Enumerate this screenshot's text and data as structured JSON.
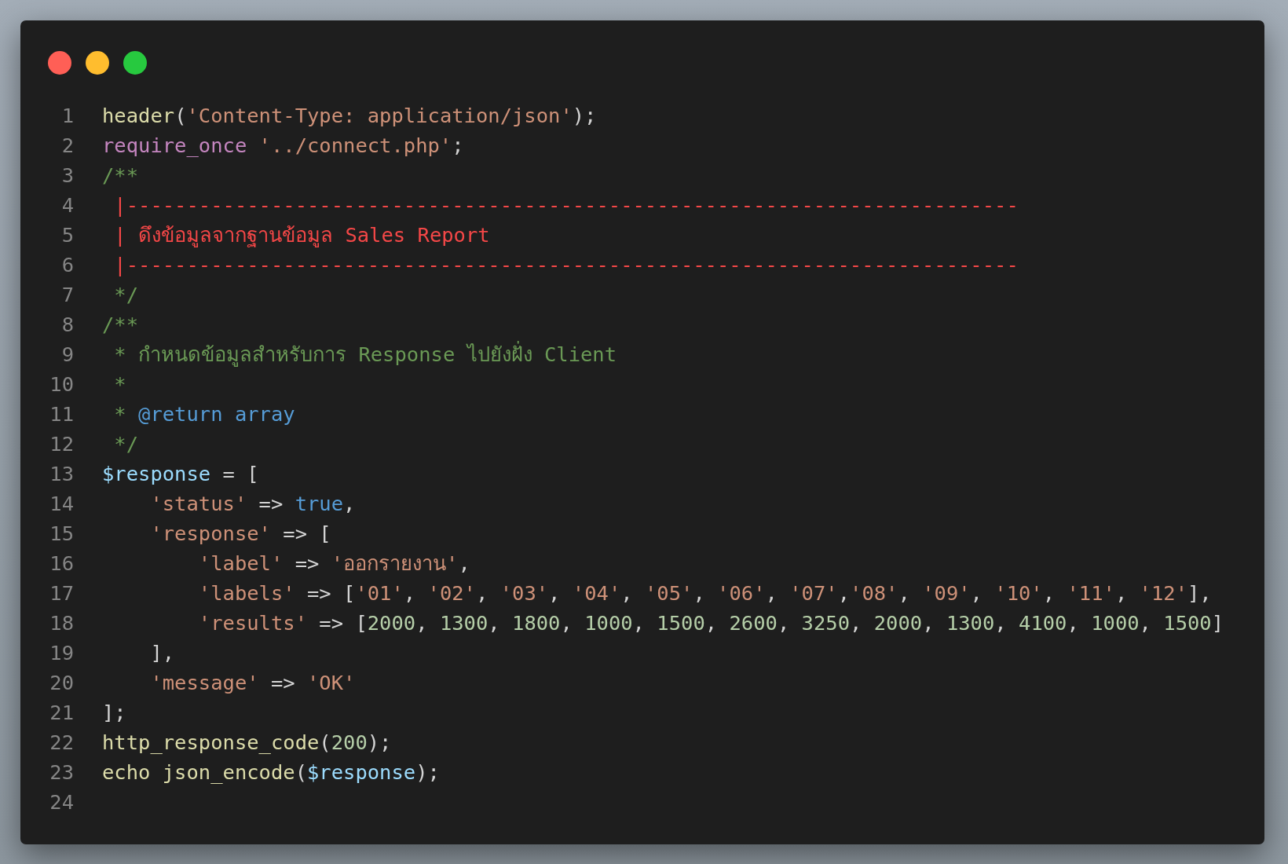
{
  "window": {
    "controls": [
      {
        "color": "#ff5f56"
      },
      {
        "color": "#ffbd2e"
      },
      {
        "color": "#27c93f"
      }
    ]
  },
  "lines": [
    {
      "number": "1",
      "tokens": [
        {
          "kind": "fn",
          "text": "header"
        },
        {
          "kind": "plain",
          "text": "("
        },
        {
          "kind": "str",
          "text": "'Content-Type: application/json'"
        },
        {
          "kind": "plain",
          "text": ");"
        }
      ]
    },
    {
      "number": "2",
      "tokens": [
        {
          "kind": "kw",
          "text": "require_once"
        },
        {
          "kind": "str",
          "text": " '../connect.php'"
        },
        {
          "kind": "plain",
          "text": ";"
        }
      ]
    },
    {
      "number": "3",
      "tokens": [
        {
          "kind": "comment",
          "text": "/**"
        }
      ]
    },
    {
      "number": "4",
      "tokens": [
        {
          "kind": "alert",
          "text": " |--------------------------------------------------------------------------"
        }
      ]
    },
    {
      "number": "5",
      "tokens": [
        {
          "kind": "alert",
          "text": " | ดึงข้อมูลจากฐานข้อมูล Sales Report"
        }
      ]
    },
    {
      "number": "6",
      "tokens": [
        {
          "kind": "alert",
          "text": " |--------------------------------------------------------------------------"
        }
      ]
    },
    {
      "number": "7",
      "tokens": [
        {
          "kind": "comment",
          "text": " */"
        }
      ]
    },
    {
      "number": "8",
      "tokens": [
        {
          "kind": "comment",
          "text": "/**"
        }
      ]
    },
    {
      "number": "9",
      "tokens": [
        {
          "kind": "comment",
          "text": " * กำหนดข้อมูลสำหรับการ Response ไปยังฝั่ง Client"
        }
      ]
    },
    {
      "number": "10",
      "tokens": [
        {
          "kind": "comment",
          "text": " *"
        }
      ]
    },
    {
      "number": "11",
      "tokens": [
        {
          "kind": "comment",
          "text": " * "
        },
        {
          "kind": "const",
          "text": "@return array"
        }
      ]
    },
    {
      "number": "12",
      "tokens": [
        {
          "kind": "comment",
          "text": " */"
        }
      ]
    },
    {
      "number": "13",
      "tokens": [
        {
          "kind": "var",
          "text": "$response"
        },
        {
          "kind": "plain",
          "text": " = ["
        }
      ]
    },
    {
      "number": "14",
      "tokens": [
        {
          "kind": "str",
          "text": "    'status'"
        },
        {
          "kind": "plain",
          "text": " => "
        },
        {
          "kind": "const",
          "text": "true"
        },
        {
          "kind": "plain",
          "text": ","
        }
      ]
    },
    {
      "number": "15",
      "tokens": [
        {
          "kind": "str",
          "text": "    'response'"
        },
        {
          "kind": "plain",
          "text": " => ["
        }
      ]
    },
    {
      "number": "16",
      "tokens": [
        {
          "kind": "str",
          "text": "        'label'"
        },
        {
          "kind": "plain",
          "text": " => "
        },
        {
          "kind": "str",
          "text": "'ออกรายงาน'"
        },
        {
          "kind": "plain",
          "text": ","
        }
      ]
    },
    {
      "number": "17",
      "tokens": [
        {
          "kind": "str",
          "text": "        'labels'"
        },
        {
          "kind": "plain",
          "text": " => ["
        },
        {
          "kind": "str",
          "text": "'01'"
        },
        {
          "kind": "plain",
          "text": ", "
        },
        {
          "kind": "str",
          "text": "'02'"
        },
        {
          "kind": "plain",
          "text": ", "
        },
        {
          "kind": "str",
          "text": "'03'"
        },
        {
          "kind": "plain",
          "text": ", "
        },
        {
          "kind": "str",
          "text": "'04'"
        },
        {
          "kind": "plain",
          "text": ", "
        },
        {
          "kind": "str",
          "text": "'05'"
        },
        {
          "kind": "plain",
          "text": ", "
        },
        {
          "kind": "str",
          "text": "'06'"
        },
        {
          "kind": "plain",
          "text": ", "
        },
        {
          "kind": "str",
          "text": "'07'"
        },
        {
          "kind": "plain",
          "text": ","
        },
        {
          "kind": "str",
          "text": "'08'"
        },
        {
          "kind": "plain",
          "text": ", "
        },
        {
          "kind": "str",
          "text": "'09'"
        },
        {
          "kind": "plain",
          "text": ", "
        },
        {
          "kind": "str",
          "text": "'10'"
        },
        {
          "kind": "plain",
          "text": ", "
        },
        {
          "kind": "str",
          "text": "'11'"
        },
        {
          "kind": "plain",
          "text": ", "
        },
        {
          "kind": "str",
          "text": "'12'"
        },
        {
          "kind": "plain",
          "text": "],"
        }
      ]
    },
    {
      "number": "18",
      "tokens": [
        {
          "kind": "str",
          "text": "        'results'"
        },
        {
          "kind": "plain",
          "text": " => ["
        },
        {
          "kind": "num",
          "text": "2000"
        },
        {
          "kind": "plain",
          "text": ", "
        },
        {
          "kind": "num",
          "text": "1300"
        },
        {
          "kind": "plain",
          "text": ", "
        },
        {
          "kind": "num",
          "text": "1800"
        },
        {
          "kind": "plain",
          "text": ", "
        },
        {
          "kind": "num",
          "text": "1000"
        },
        {
          "kind": "plain",
          "text": ", "
        },
        {
          "kind": "num",
          "text": "1500"
        },
        {
          "kind": "plain",
          "text": ", "
        },
        {
          "kind": "num",
          "text": "2600"
        },
        {
          "kind": "plain",
          "text": ", "
        },
        {
          "kind": "num",
          "text": "3250"
        },
        {
          "kind": "plain",
          "text": ", "
        },
        {
          "kind": "num",
          "text": "2000"
        },
        {
          "kind": "plain",
          "text": ", "
        },
        {
          "kind": "num",
          "text": "1300"
        },
        {
          "kind": "plain",
          "text": ", "
        },
        {
          "kind": "num",
          "text": "4100"
        },
        {
          "kind": "plain",
          "text": ", "
        },
        {
          "kind": "num",
          "text": "1000"
        },
        {
          "kind": "plain",
          "text": ", "
        },
        {
          "kind": "num",
          "text": "1500"
        },
        {
          "kind": "plain",
          "text": "]"
        }
      ]
    },
    {
      "number": "19",
      "tokens": [
        {
          "kind": "plain",
          "text": "    ],"
        }
      ]
    },
    {
      "number": "20",
      "tokens": [
        {
          "kind": "str",
          "text": "    'message'"
        },
        {
          "kind": "plain",
          "text": " => "
        },
        {
          "kind": "str",
          "text": "'OK'"
        }
      ]
    },
    {
      "number": "21",
      "tokens": [
        {
          "kind": "plain",
          "text": "];"
        }
      ]
    },
    {
      "number": "22",
      "tokens": [
        {
          "kind": "fn",
          "text": "http_response_code"
        },
        {
          "kind": "plain",
          "text": "("
        },
        {
          "kind": "num",
          "text": "200"
        },
        {
          "kind": "plain",
          "text": ");"
        }
      ]
    },
    {
      "number": "23",
      "tokens": [
        {
          "kind": "fn",
          "text": "echo json_encode"
        },
        {
          "kind": "plain",
          "text": "("
        },
        {
          "kind": "var",
          "text": "$response"
        },
        {
          "kind": "plain",
          "text": ");"
        }
      ]
    },
    {
      "number": "24"
    }
  ]
}
